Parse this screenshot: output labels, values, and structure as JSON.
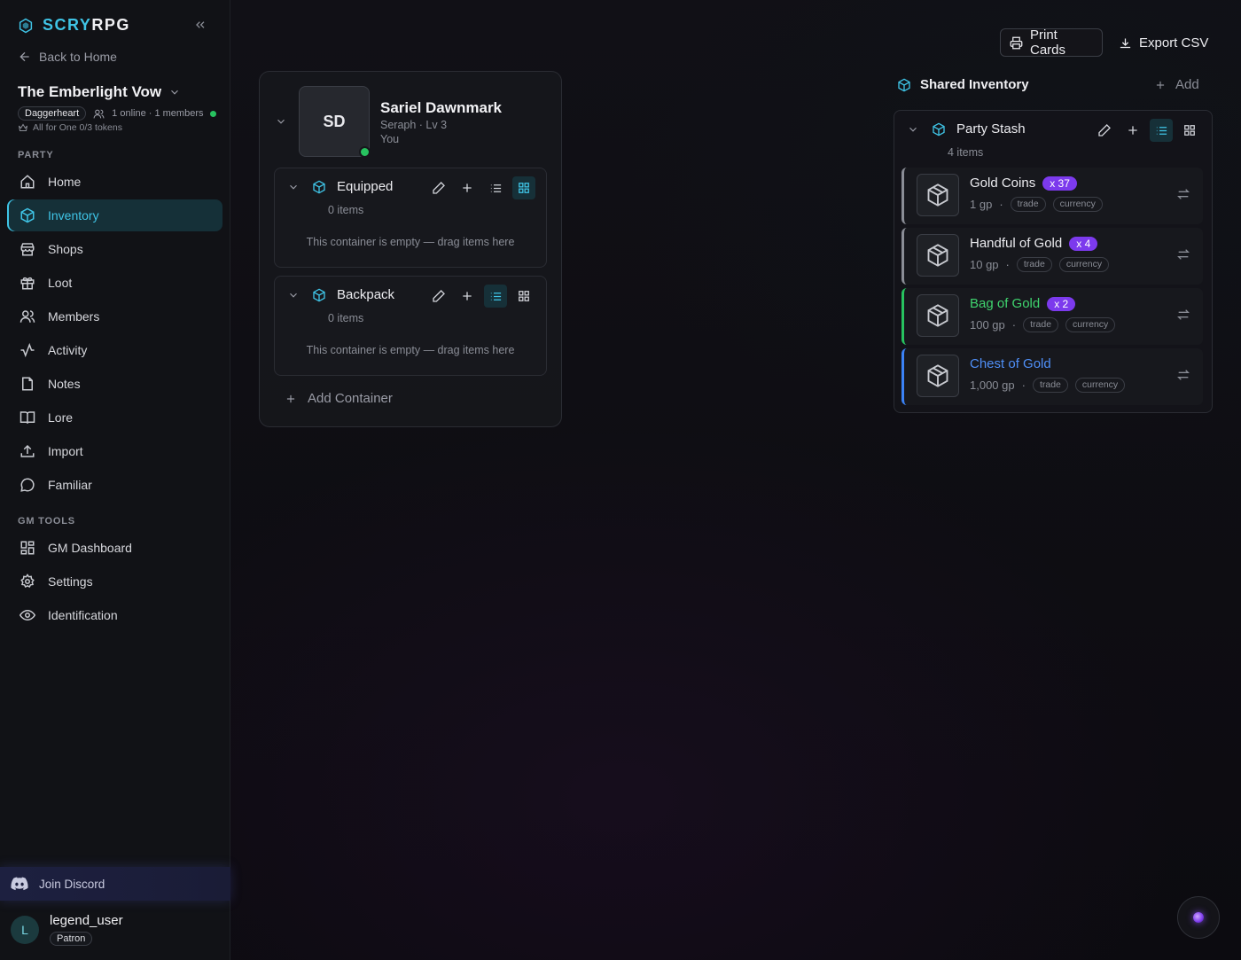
{
  "brand": {
    "prefix": "SCRY",
    "suffix": "RPG"
  },
  "sidebar": {
    "back_label": "Back to Home",
    "campaign_name": "The Emberlight Vow",
    "system_badge": "Daggerheart",
    "presence": "1 online · 1 members",
    "tokens": "All for One 0/3 tokens",
    "party_label": "PARTY",
    "party_items": [
      {
        "label": "Home",
        "icon": "home-icon"
      },
      {
        "label": "Inventory",
        "icon": "box-icon",
        "active": true
      },
      {
        "label": "Shops",
        "icon": "store-icon"
      },
      {
        "label": "Loot",
        "icon": "gift-icon"
      },
      {
        "label": "Members",
        "icon": "users-icon"
      },
      {
        "label": "Activity",
        "icon": "activity-icon"
      },
      {
        "label": "Notes",
        "icon": "note-icon"
      },
      {
        "label": "Lore",
        "icon": "book-icon"
      },
      {
        "label": "Import",
        "icon": "upload-icon"
      },
      {
        "label": "Familiar",
        "icon": "chat-bubble-icon"
      }
    ],
    "gm_label": "GM TOOLS",
    "gm_items": [
      {
        "label": "GM Dashboard",
        "icon": "dashboard-icon"
      },
      {
        "label": "Settings",
        "icon": "gear-icon"
      },
      {
        "label": "Identification",
        "icon": "eye-icon"
      }
    ],
    "discord_label": "Join Discord",
    "user": {
      "initial": "L",
      "name": "legend_user",
      "badge": "Patron"
    }
  },
  "toolbar": {
    "print_label": "Print Cards",
    "export_label": "Export CSV"
  },
  "character": {
    "initials": "SD",
    "name": "Sariel Dawnmark",
    "subtitle": "Seraph · Lv 3",
    "owner": "You",
    "containers": [
      {
        "name": "Equipped",
        "count": "0 items",
        "empty": "This container is empty — drag items here",
        "view": "grid"
      },
      {
        "name": "Backpack",
        "count": "0 items",
        "empty": "This container is empty — drag items here",
        "view": "list"
      }
    ],
    "add_container_label": "Add Container"
  },
  "shared": {
    "title": "Shared Inventory",
    "add_label": "Add",
    "stash": {
      "name": "Party Stash",
      "count": "4 items",
      "items": [
        {
          "name": "Gold Coins",
          "qty": "x 37",
          "price": "1 gp",
          "tags": [
            "trade",
            "currency"
          ],
          "rarity_color": "#8a8d96",
          "name_color": "#ececf0"
        },
        {
          "name": "Handful of Gold",
          "qty": "x 4",
          "price": "10 gp",
          "tags": [
            "trade",
            "currency"
          ],
          "rarity_color": "#8a8d96",
          "name_color": "#ececf0"
        },
        {
          "name": "Bag of Gold",
          "qty": "x 2",
          "price": "100 gp",
          "tags": [
            "trade",
            "currency"
          ],
          "rarity_color": "#27c25f",
          "name_color": "#3fd46e"
        },
        {
          "name": "Chest of Gold",
          "qty": "",
          "price": "1,000 gp",
          "tags": [
            "trade",
            "currency"
          ],
          "rarity_color": "#3b82f6",
          "name_color": "#4f8ff7"
        }
      ]
    }
  },
  "colors": {
    "accent": "#3fc4e6",
    "online": "#27c25f",
    "qty_badge": "#7c3aed"
  }
}
